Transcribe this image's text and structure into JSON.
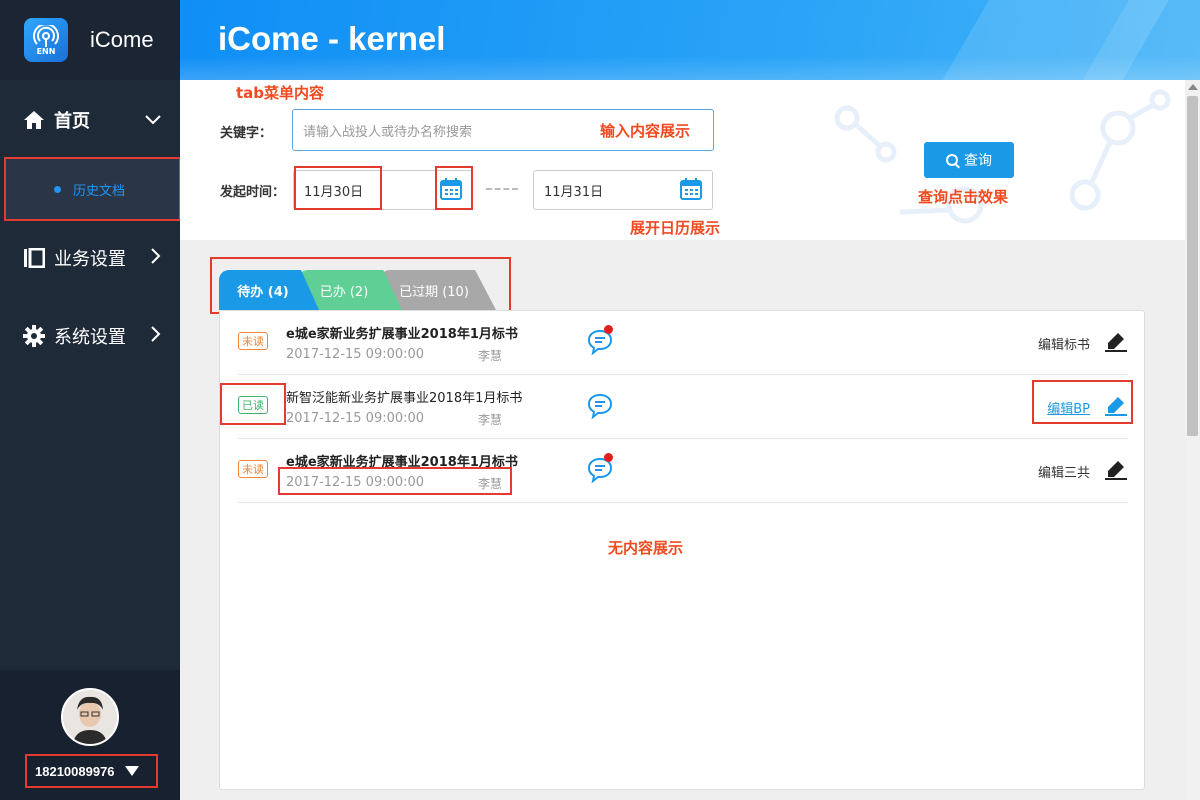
{
  "app": {
    "name": "iCome",
    "logo_text": "ENN"
  },
  "header": {
    "title": "iCome - kernel"
  },
  "sidebar": {
    "items": [
      {
        "label": "首页",
        "icon": "home-icon"
      },
      {
        "label": "业务设置",
        "icon": "layout-icon"
      },
      {
        "label": "系统设置",
        "icon": "gear-icon"
      }
    ],
    "sub_item": {
      "label": "历史文档"
    },
    "user": {
      "phone": "18210089976"
    }
  },
  "annotations": {
    "tab_menu": "tab菜单内容",
    "input_display": "输入内容展示",
    "query_effect": "查询点击效果",
    "calendar_expand": "展开日历展示",
    "no_content": "无内容展示"
  },
  "search": {
    "keyword_label": "关键字：",
    "keyword_placeholder": "请输入战投人或待办名称搜索",
    "time_label": "发起时间：",
    "start_date": "11月30日",
    "end_date": "11月31日",
    "query_label": "查询"
  },
  "tabs": [
    {
      "label": "待办 (4)"
    },
    {
      "label": "已办 (2)"
    },
    {
      "label": "已过期 (10)"
    }
  ],
  "rows": [
    {
      "badge": "未读",
      "title": "e城e家新业务扩展事业2018年1月标书",
      "date": "2017-12-15 09:00:00",
      "person": "李慧",
      "edit": "编辑标书"
    },
    {
      "badge": "已读",
      "title": "新智泛能新业务扩展事业2018年1月标书",
      "date": "2017-12-15 09:00:00",
      "person": "李慧",
      "edit": "编辑BP"
    },
    {
      "badge": "未读",
      "title": "e城e家新业务扩展事业2018年1月标书",
      "date": "2017-12-15 09:00:00",
      "person": "李慧",
      "edit": "编辑三共"
    }
  ],
  "colors": {
    "primary": "#1a9ae6",
    "sidebar": "#1f2a39",
    "annotation": "#f04a1e",
    "highlight_box": "#e53a2f"
  }
}
